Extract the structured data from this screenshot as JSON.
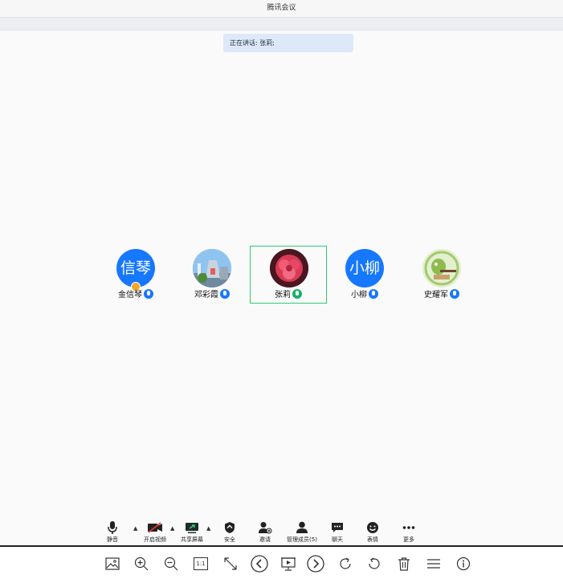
{
  "window": {
    "title": "腾讯会议"
  },
  "speaking": {
    "text": "正在讲话: 张莉;"
  },
  "participants": [
    {
      "name": "金信琴",
      "avatar_text": "信琴",
      "mic": "blue",
      "host": true,
      "active": false
    },
    {
      "name": "邓彩霞",
      "avatar_text": "",
      "mic": "blue",
      "host": false,
      "active": false
    },
    {
      "name": "张莉",
      "avatar_text": "",
      "mic": "green",
      "host": false,
      "active": true
    },
    {
      "name": "小柳",
      "avatar_text": "小柳",
      "mic": "blue",
      "host": false,
      "active": false
    },
    {
      "name": "史耀军",
      "avatar_text": "",
      "mic": "blue",
      "host": false,
      "active": false
    }
  ],
  "toolbar": {
    "mute": "静音",
    "video": "开启视频",
    "share": "共享屏幕",
    "security": "安全",
    "invite": "邀请",
    "members": "管理成员(5)",
    "chat": "聊天",
    "emoji": "表情",
    "more": "更多"
  },
  "viewer": {
    "actual_size": "1:1"
  },
  "colors": {
    "accent": "#1677ff",
    "active_border": "#2ecc71",
    "speaker_bg": "#dde9f9"
  }
}
